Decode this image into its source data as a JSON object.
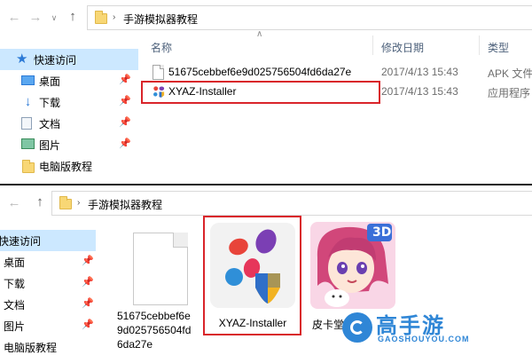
{
  "top": {
    "address": {
      "path": "手游模拟器教程"
    },
    "sidebar": [
      {
        "label": "快速访问",
        "icon": "star-icon",
        "selected": true,
        "pinned": false
      },
      {
        "label": "桌面",
        "icon": "desktop-icon",
        "selected": false,
        "pinned": true
      },
      {
        "label": "下载",
        "icon": "download-icon",
        "selected": false,
        "pinned": true
      },
      {
        "label": "文档",
        "icon": "document-icon",
        "selected": false,
        "pinned": true
      },
      {
        "label": "图片",
        "icon": "picture-icon",
        "selected": false,
        "pinned": true
      },
      {
        "label": "电脑版教程",
        "icon": "folder-icon",
        "selected": false,
        "pinned": false
      }
    ],
    "columns": {
      "name": "名称",
      "date": "修改日期",
      "type": "类型"
    },
    "files": [
      {
        "name": "51675cebbef6e9d025756504fd6da27e",
        "date": "2017/4/13 15:43",
        "type": "APK 文件",
        "icon": "blank-file-icon"
      },
      {
        "name": "XYAZ-Installer",
        "date": "2017/4/13 15:43",
        "type": "应用程序",
        "icon": "xyaz-app-icon",
        "highlighted": true
      }
    ]
  },
  "bottom": {
    "address": {
      "path": "手游模拟器教程"
    },
    "sidebar": [
      {
        "label": "快速访问",
        "icon": "star-icon",
        "selected": true,
        "pinned": false
      },
      {
        "label": "桌面",
        "icon": "desktop-icon",
        "selected": false,
        "pinned": true
      },
      {
        "label": "下载",
        "icon": "download-icon",
        "selected": false,
        "pinned": true
      },
      {
        "label": "文档",
        "icon": "document-icon",
        "selected": false,
        "pinned": true
      },
      {
        "label": "图片",
        "icon": "picture-icon",
        "selected": false,
        "pinned": true
      },
      {
        "label": "电脑版教程",
        "icon": "folder-icon",
        "selected": false,
        "pinned": false
      }
    ],
    "tiles": [
      {
        "line1": "51675cebbef6e",
        "line2": "9d025756504fd",
        "line3": "6da27e",
        "icon": "blank-file-icon"
      },
      {
        "label": "XYAZ-Installer",
        "icon": "xyaz-app-icon",
        "highlighted": true
      },
      {
        "label": "皮卡堂3D",
        "icon": "game-art-icon",
        "badge": "3D"
      }
    ]
  },
  "watermark": {
    "brand": "高手游",
    "site": "GAOSHOUYOU.COM"
  },
  "colors": {
    "highlight_box": "#d9242a",
    "selected_row": "#cce8ff",
    "accent": "#2b79d6"
  }
}
